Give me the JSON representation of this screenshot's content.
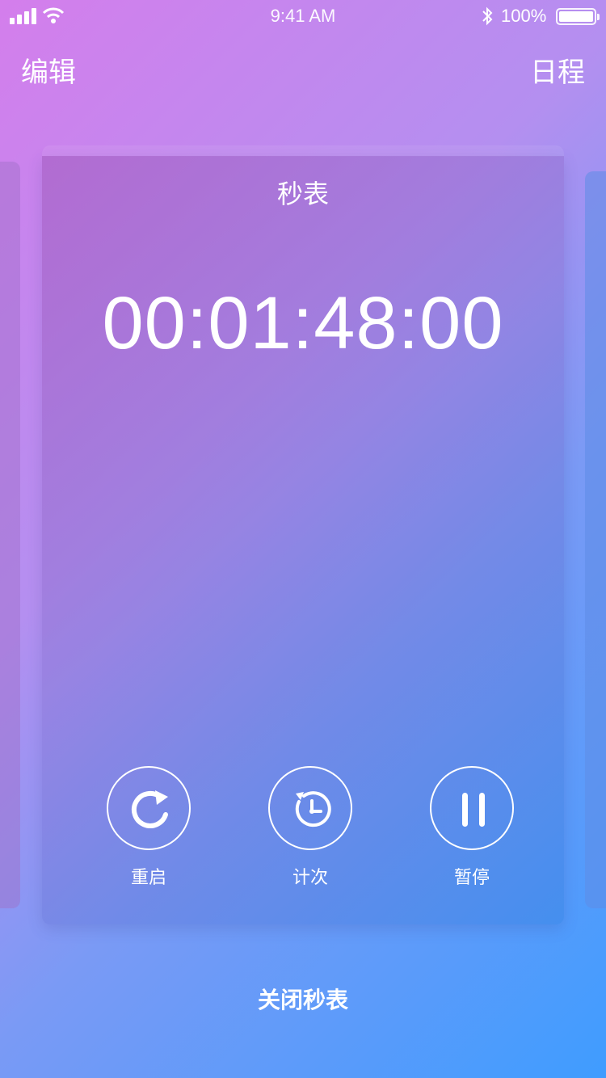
{
  "status_bar": {
    "time": "9:41 AM",
    "battery": "100%"
  },
  "nav": {
    "left_label": "编辑",
    "right_label": "日程"
  },
  "card": {
    "title": "秒表",
    "timer": "00:01:48:00",
    "controls": [
      {
        "label": "重启",
        "icon": "restart-icon"
      },
      {
        "label": "计次",
        "icon": "lap-clock-icon"
      },
      {
        "label": "暂停",
        "icon": "pause-icon"
      }
    ]
  },
  "footer": {
    "close_label": "关闭秒表"
  }
}
